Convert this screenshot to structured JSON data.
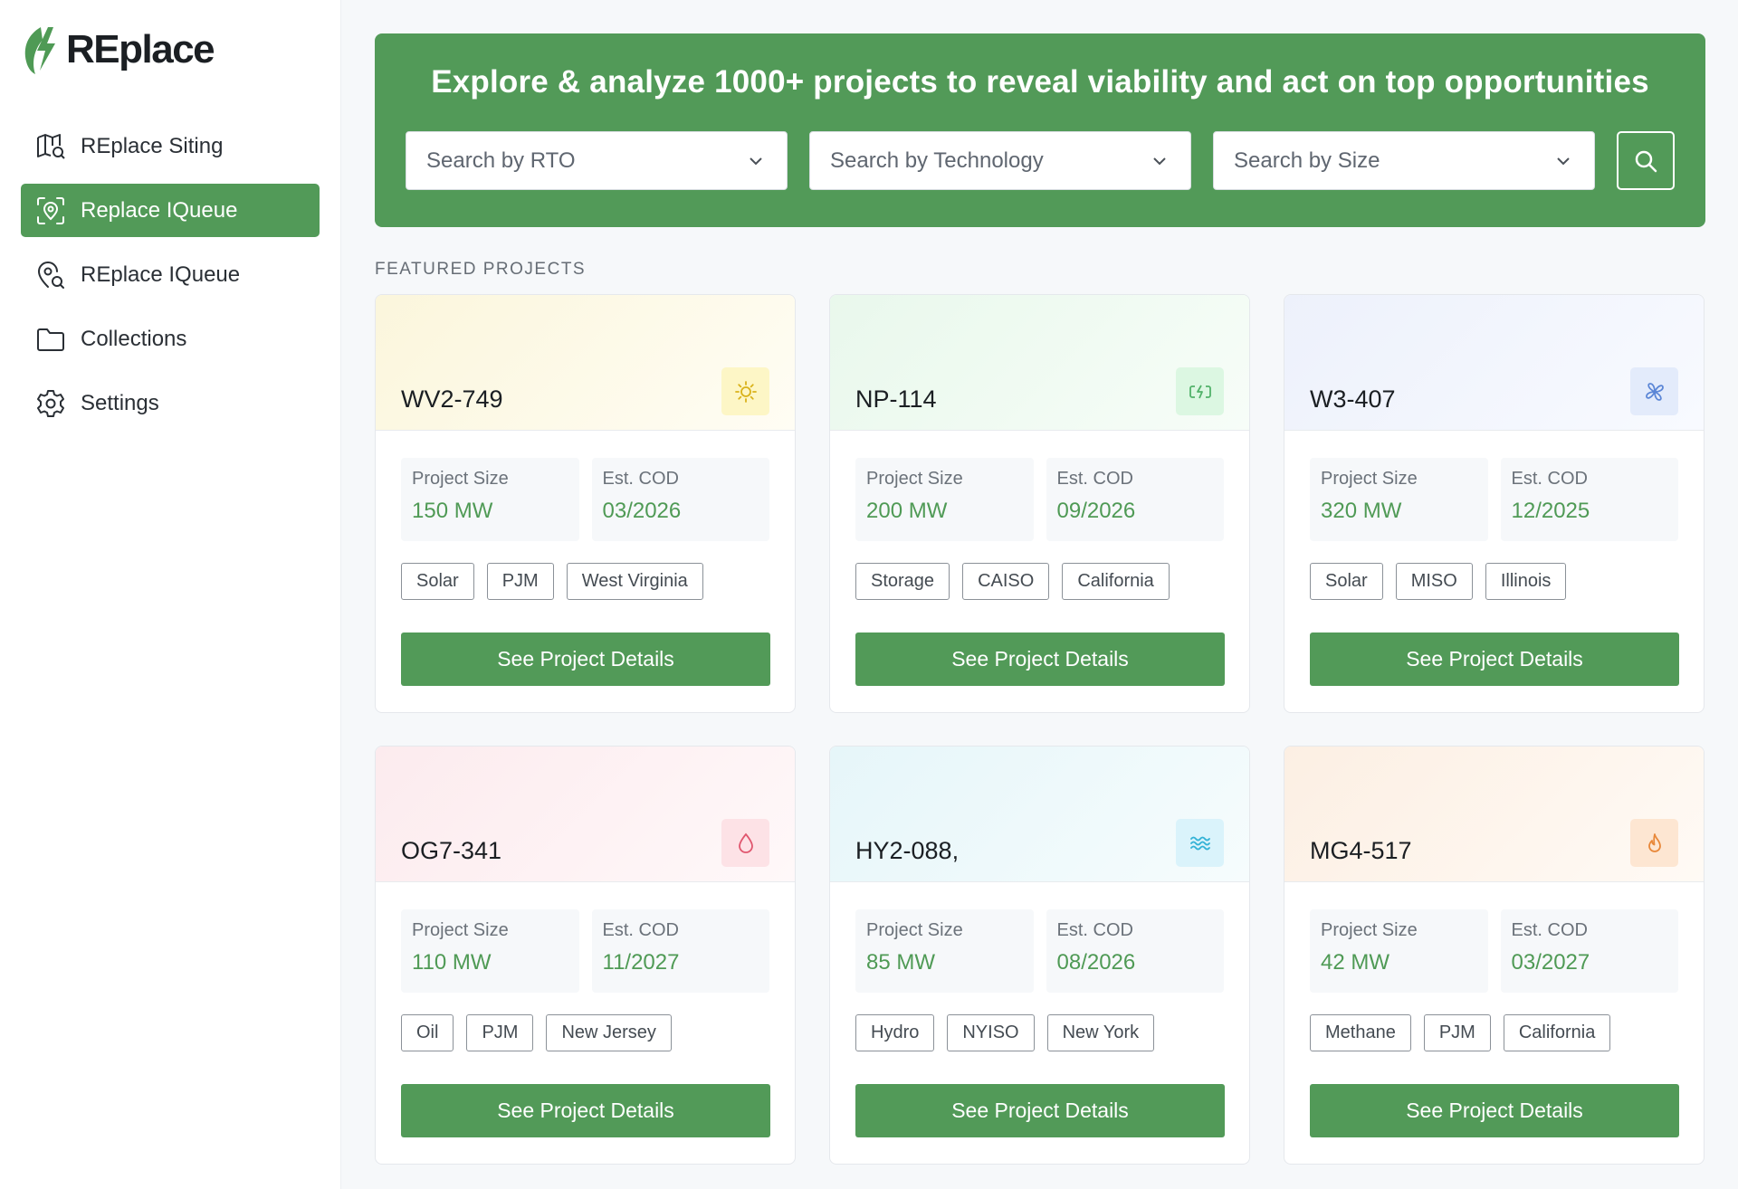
{
  "brand": {
    "name": "REplace",
    "icon": "leaf-bolt-logo",
    "accent": "#529a58"
  },
  "sidebar": {
    "items": [
      {
        "label": "REplace Siting",
        "icon": "map-search-icon",
        "active": false
      },
      {
        "label": "Replace IQueue",
        "icon": "focus-pin-icon",
        "active": true
      },
      {
        "label": "REplace IQueue",
        "icon": "location-search-icon",
        "active": false
      },
      {
        "label": "Collections",
        "icon": "folder-icon",
        "active": false
      },
      {
        "label": "Settings",
        "icon": "gear-icon",
        "active": false
      }
    ]
  },
  "hero": {
    "title": "Explore & analyze 1000+ projects to reveal viability and act on top opportunities",
    "filters": [
      {
        "placeholder": "Search by RTO"
      },
      {
        "placeholder": "Search by Technology"
      },
      {
        "placeholder": "Search by Size"
      }
    ],
    "search_icon": "search-icon"
  },
  "featured": {
    "label": "FEATURED PROJECTS",
    "size_label": "Project Size",
    "cod_label": "Est. COD",
    "cta_label": "See Project Details",
    "projects": [
      {
        "id": "WV2-749",
        "size": "150 MW",
        "cod": "03/2026",
        "tags": [
          "Solar",
          "PJM",
          "West Virginia"
        ],
        "icon": "sun-icon",
        "badge_bg": "#fdf6c6",
        "icon_color": "#d9b21a",
        "head_from": "#fbf6dc",
        "head_to": "#fffdf4"
      },
      {
        "id": "NP-114",
        "size": "200 MW",
        "cod": "09/2026",
        "tags": [
          "Storage",
          "CAISO",
          "California"
        ],
        "icon": "battery-bolt-icon",
        "badge_bg": "#dcf7e2",
        "icon_color": "#52b26a",
        "head_from": "#e9f8ec",
        "head_to": "#f7fdf8"
      },
      {
        "id": "W3-407",
        "size": "320 MW",
        "cod": "12/2025",
        "tags": [
          "Solar",
          "MISO",
          "Illinois"
        ],
        "icon": "fan-icon",
        "badge_bg": "#e3ebfb",
        "icon_color": "#5b86d6",
        "head_from": "#edf1fb",
        "head_to": "#f8faff"
      },
      {
        "id": "OG7-341",
        "size": "110 MW",
        "cod": "11/2027",
        "tags": [
          "Oil",
          "PJM",
          "New Jersey"
        ],
        "icon": "drop-icon",
        "badge_bg": "#fde2e6",
        "icon_color": "#e0566e",
        "head_from": "#fcebee",
        "head_to": "#fff8f9"
      },
      {
        "id": "HY2-088,",
        "size": "85 MW",
        "cod": "08/2026",
        "tags": [
          "Hydro",
          "NYISO",
          "New York"
        ],
        "icon": "waves-icon",
        "badge_bg": "#daf3fb",
        "icon_color": "#33b2d6",
        "head_from": "#e6f6f9",
        "head_to": "#f6fcfd"
      },
      {
        "id": "MG4-517",
        "size": "42 MW",
        "cod": "03/2027",
        "tags": [
          "Methane",
          "PJM",
          "California"
        ],
        "icon": "flame-icon",
        "badge_bg": "#fde6d2",
        "icon_color": "#e8883a",
        "head_from": "#fcefe3",
        "head_to": "#fffaf5"
      }
    ]
  }
}
